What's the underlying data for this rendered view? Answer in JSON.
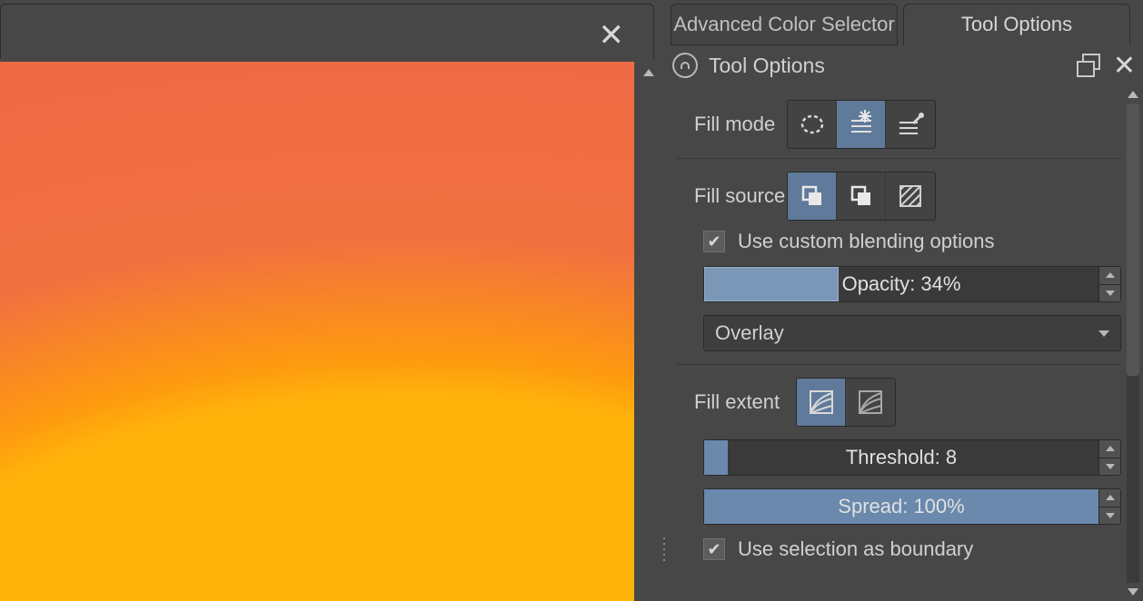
{
  "tabs": {
    "advanced_color_selector": "Advanced Color Selector",
    "tool_options": "Tool Options"
  },
  "panel": {
    "title": "Tool Options"
  },
  "fill_mode": {
    "label": "Fill mode",
    "selected_index": 1
  },
  "fill_source": {
    "label": "Fill source",
    "selected_index": 0
  },
  "custom_blending": {
    "label": "Use custom blending options",
    "checked": true
  },
  "opacity": {
    "label": "Opacity: 34%",
    "value": 34,
    "max": 100
  },
  "blend_mode": {
    "value": "Overlay"
  },
  "fill_extent": {
    "label": "Fill extent",
    "selected_index": 0
  },
  "threshold": {
    "label": "Threshold: 8",
    "value": 8,
    "max": 255
  },
  "spread": {
    "label": "Spread: 100%",
    "value": 100,
    "max": 100
  },
  "use_selection_boundary": {
    "label": "Use selection as boundary",
    "checked": true
  }
}
